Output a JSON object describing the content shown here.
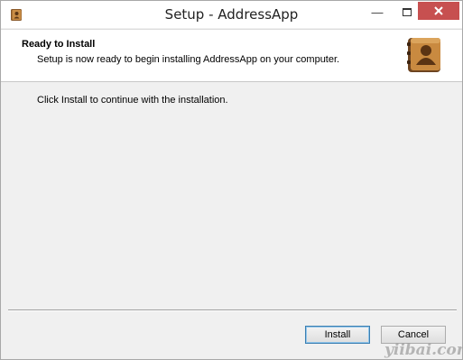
{
  "window": {
    "title": "Setup - AddressApp",
    "icon": "address-book-icon",
    "controls": {
      "minimize_icon": "minimize-icon",
      "maximize_icon": "maximize-icon",
      "close_icon": "close-icon",
      "close_color": "#c75050"
    }
  },
  "header": {
    "title": "Ready to Install",
    "subtitle": "Setup is now ready to begin installing AddressApp on your computer.",
    "icon": "address-book-icon"
  },
  "main": {
    "text": "Click Install to continue with the installation."
  },
  "footer": {
    "install_label": "Install",
    "cancel_label": "Cancel"
  },
  "watermark": "yiibai.com"
}
